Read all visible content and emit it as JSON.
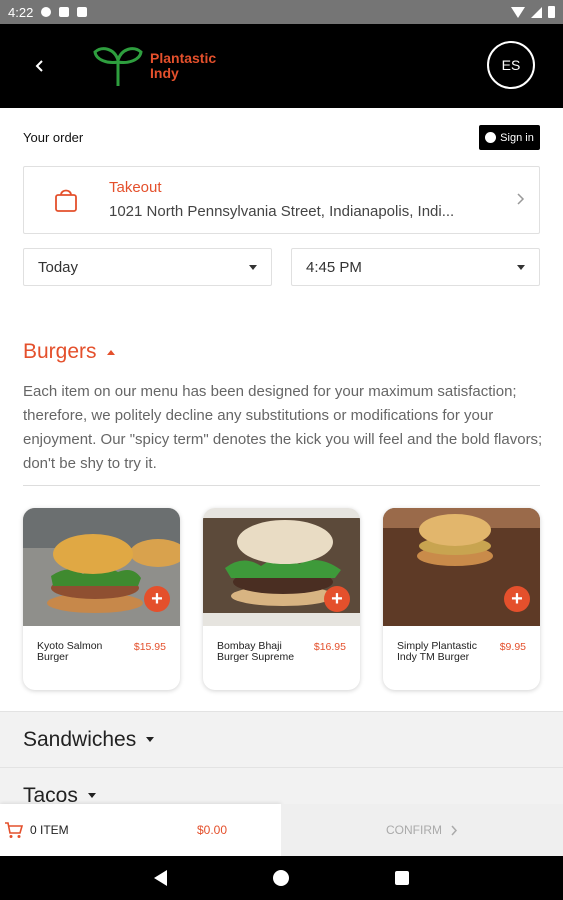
{
  "status_bar": {
    "time": "4:22"
  },
  "header": {
    "logo_line1": "Plantastic",
    "logo_line2": "Indy",
    "language": "ES"
  },
  "order": {
    "title": "Your order",
    "sign_in": "Sign in",
    "mode": "Takeout",
    "address": "1021 North Pennsylvania Street, Indianapolis, Indi...",
    "date": "Today",
    "time": "4:45 PM"
  },
  "menu": {
    "category": "Burgers",
    "description": "Each item on our menu has been designed for your maximum satisfaction; therefore, we politely decline any substitutions or modifications for your enjoyment. Our \"spicy term\" denotes the kick you will feel and the bold flavors; don't be shy to try it.",
    "items": [
      {
        "name": "Kyoto Salmon Burger",
        "price": "$15.95"
      },
      {
        "name": "Bombay Bhaji Burger Supreme",
        "price": "$16.95"
      },
      {
        "name": "Simply Plantastic Indy TM Burger",
        "price": "$9.95"
      }
    ],
    "other_categories": [
      "Sandwiches",
      "Tacos"
    ]
  },
  "cart": {
    "count_label": "0 ITEM",
    "total": "$0.00",
    "confirm": "CONFIRM"
  },
  "colors": {
    "accent": "#e4502c",
    "header_bg": "#000000"
  },
  "icons": [
    "back-icon",
    "logo-sprout-icon",
    "user-icon",
    "shopping-bag-icon",
    "chevron-right-icon",
    "plus-icon",
    "cart-icon"
  ]
}
